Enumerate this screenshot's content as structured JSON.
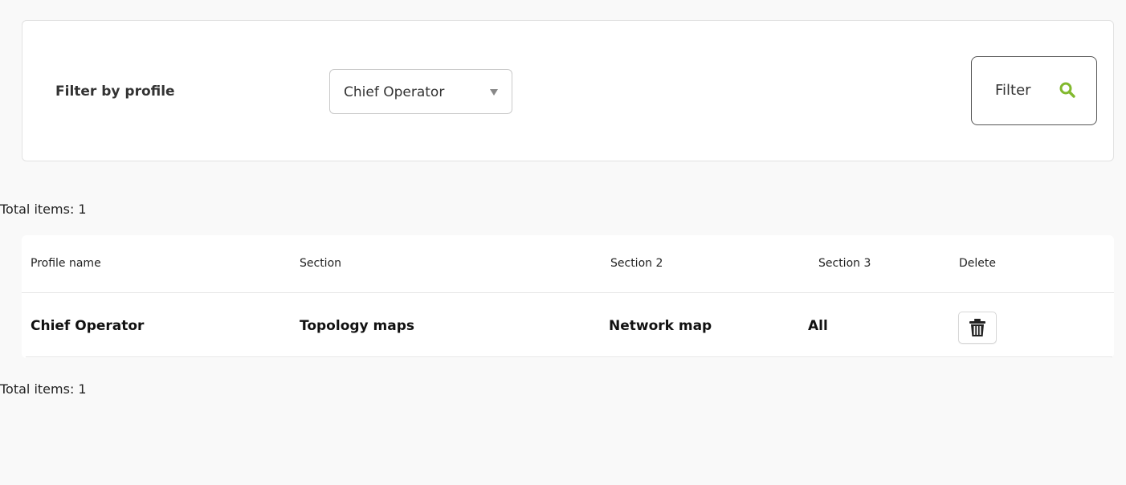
{
  "filter": {
    "label": "Filter by profile",
    "profile_select": {
      "selected": "Chief Operator"
    },
    "button_label": "Filter",
    "icon": "search-icon",
    "accent_color": "#82b92e"
  },
  "summary": {
    "total_items_top": "Total items: 1",
    "total_items_bottom": "Total items: 1"
  },
  "table": {
    "headers": [
      "Profile name",
      "Section",
      "Section 2",
      "Section 3",
      "Delete"
    ],
    "rows": [
      {
        "profile_name": "Chief Operator",
        "section": "Topology maps",
        "section_2": "Network map",
        "section_3": "All",
        "delete_icon": "trash-icon"
      }
    ]
  }
}
